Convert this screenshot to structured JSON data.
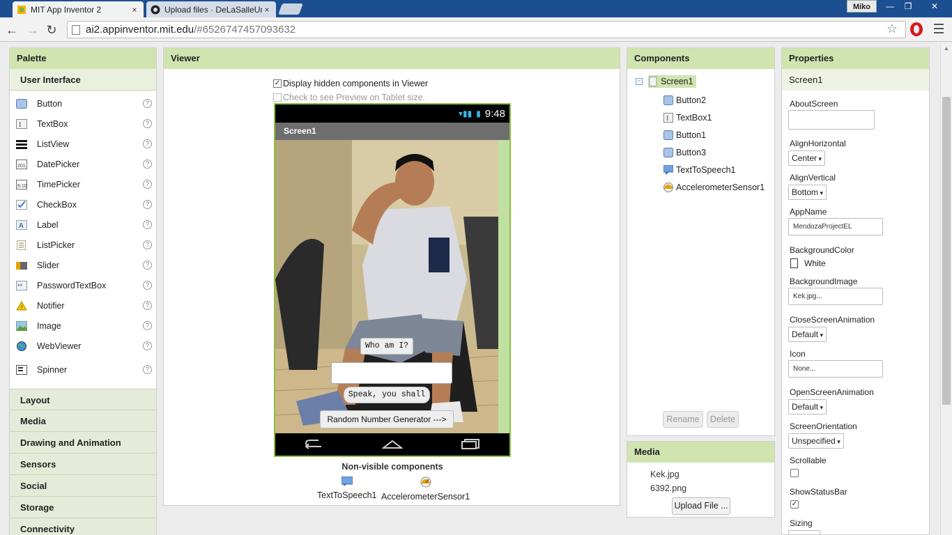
{
  "browser": {
    "tabs": [
      {
        "title": "MIT App Inventor 2",
        "close": "×"
      },
      {
        "title": "Upload files · DeLaSalleUn",
        "close": "×"
      }
    ],
    "user": "Miko",
    "url_host": "ai2.appinventor.mit.edu",
    "url_path": "/#6526747457093632"
  },
  "palette": {
    "title": "Palette",
    "open_category": "User Interface",
    "items": [
      {
        "label": "Button",
        "icon": "button-icon"
      },
      {
        "label": "TextBox",
        "icon": "textbox-icon"
      },
      {
        "label": "ListView",
        "icon": "listview-icon"
      },
      {
        "label": "DatePicker",
        "icon": "datepicker-icon"
      },
      {
        "label": "TimePicker",
        "icon": "timepicker-icon"
      },
      {
        "label": "CheckBox",
        "icon": "checkbox-icon"
      },
      {
        "label": "Label",
        "icon": "label-icon"
      },
      {
        "label": "ListPicker",
        "icon": "listpicker-icon"
      },
      {
        "label": "Slider",
        "icon": "slider-icon"
      },
      {
        "label": "PasswordTextBox",
        "icon": "passwordtextbox-icon"
      },
      {
        "label": "Notifier",
        "icon": "notifier-icon"
      },
      {
        "label": "Image",
        "icon": "image-icon"
      },
      {
        "label": "WebViewer",
        "icon": "webviewer-icon"
      },
      {
        "label": "Spinner",
        "icon": "spinner-icon"
      }
    ],
    "help_glyph": "?",
    "categories": [
      "Layout",
      "Media",
      "Drawing and Animation",
      "Sensors",
      "Social",
      "Storage",
      "Connectivity"
    ]
  },
  "viewer": {
    "title": "Viewer",
    "display_hidden": "Display hidden components in Viewer",
    "tablet_preview": "Check to see Preview on Tablet size.",
    "time": "9:48",
    "screen_title": "Screen1",
    "btn_who": "Who am I?",
    "btn_speak": "Speak, you shall",
    "btn_random": "Random Number Generator --->",
    "nonvisible_title": "Non-visible components",
    "nonvisible": [
      "TextToSpeech1",
      "AccelerometerSensor1"
    ]
  },
  "components": {
    "title": "Components",
    "root": "Screen1",
    "children": [
      "Button2",
      "TextBox1",
      "Button1",
      "Button3",
      "TextToSpeech1",
      "AccelerometerSensor1"
    ],
    "rename": "Rename",
    "delete": "Delete"
  },
  "media": {
    "title": "Media",
    "files": [
      "Kek.jpg",
      "6392.png"
    ],
    "upload": "Upload File ..."
  },
  "properties": {
    "title": "Properties",
    "component": "Screen1",
    "about_label": "AboutScreen",
    "alignh_label": "AlignHorizontal",
    "alignh_value": "Center",
    "alignv_label": "AlignVertical",
    "alignv_value": "Bottom",
    "appname_label": "AppName",
    "appname_value": "MendozaProjectEL",
    "bgcolor_label": "BackgroundColor",
    "bgcolor_value": "White",
    "bgimage_label": "BackgroundImage",
    "bgimage_value": "Kek.jpg...",
    "closeanim_label": "CloseScreenAnimation",
    "closeanim_value": "Default",
    "icon_label": "Icon",
    "icon_value": "None...",
    "openanim_label": "OpenScreenAnimation",
    "openanim_value": "Default",
    "orientation_label": "ScreenOrientation",
    "orientation_value": "Unspecified",
    "scrollable_label": "Scrollable",
    "statusbar_label": "ShowStatusBar",
    "sizing_label": "Sizing"
  },
  "colors": {
    "accent_green": "#d0e4b0",
    "phone_border": "#8bbf3e",
    "browser_blue": "#1c4f91"
  }
}
